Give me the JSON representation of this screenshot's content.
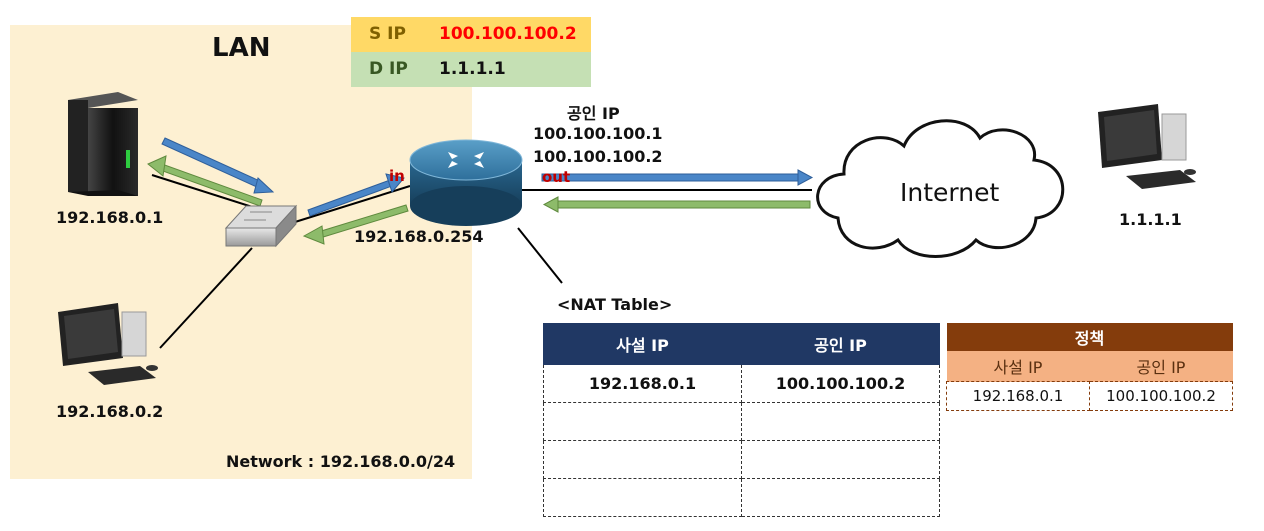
{
  "lan": {
    "title": "LAN",
    "network": "Network : 192.168.0.0/24"
  },
  "packet": {
    "sip_key": "S IP",
    "sip_val": "100.100.100.2",
    "dip_key": "D IP",
    "dip_val": "1.1.1.1",
    "colors": {
      "sip_bg": "#ffd966",
      "dip_bg": "#c5e0b4",
      "sip_val": "#ff0000",
      "sip_key": "#7f6000",
      "dip_key": "#385723"
    }
  },
  "hosts": {
    "server": "192.168.0.1",
    "pc": "192.168.0.2",
    "remote": "1.1.1.1"
  },
  "router": {
    "ip": "192.168.0.254",
    "in_label": "in",
    "out_label": "out",
    "public_title": "공인 IP",
    "public_ip1": "100.100.100.1",
    "public_ip2": "100.100.100.2"
  },
  "internet": {
    "label": "Internet"
  },
  "nat_table": {
    "title": "<NAT Table>",
    "headers": [
      "사설 IP",
      "공인 IP"
    ],
    "rows": [
      [
        "192.168.0.1",
        "100.100.100.2"
      ],
      [
        "",
        ""
      ],
      [
        "",
        ""
      ],
      [
        "",
        ""
      ]
    ]
  },
  "policy": {
    "title": "정책",
    "headers": [
      "사설 IP",
      "공인 IP"
    ],
    "row": [
      "192.168.0.1",
      "100.100.100.2"
    ]
  }
}
